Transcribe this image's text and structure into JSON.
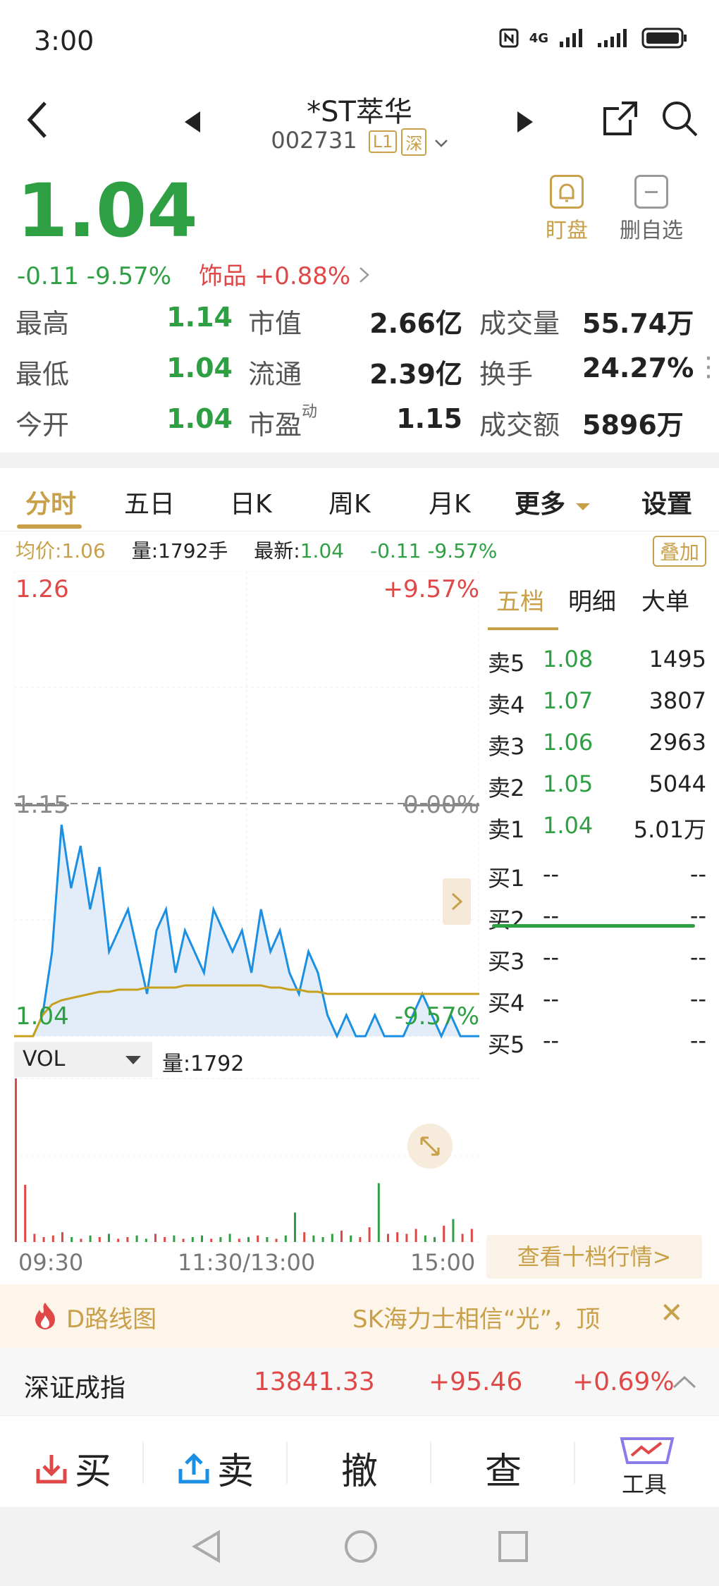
{
  "status": {
    "time": "3:00",
    "network": "4G"
  },
  "header": {
    "name": "*ST萃华",
    "code": "002731",
    "level": "L1",
    "market": "深"
  },
  "quote": {
    "price": "1.04",
    "change": "-0.11",
    "change_pct": "-9.57%",
    "sector_name": "饰品",
    "sector_change": "+0.88%"
  },
  "actions_top": {
    "watch": "盯盘",
    "remove": "删自选"
  },
  "stats": {
    "high_label": "最高",
    "high": "1.14",
    "low_label": "最低",
    "low": "1.04",
    "open_label": "今开",
    "open": "1.04",
    "mcap_label": "市值",
    "mcap": "2.66亿",
    "float_label": "流通",
    "float": "2.39亿",
    "pe_label": "市盈",
    "pe_sup": "动",
    "pe": "1.15",
    "vol_label": "成交量",
    "vol": "55.74万",
    "turnover_label": "换手",
    "turnover": "24.27%",
    "amount_label": "成交额",
    "amount": "5896万"
  },
  "tabs": [
    "分时",
    "五日",
    "日K",
    "周K",
    "月K",
    "更多",
    "设置"
  ],
  "infobar": {
    "avg": "均价:1.06",
    "volume": "量:1792手",
    "latest_label": "最新:",
    "latest": "1.04",
    "chg": "-0.11 -9.57%",
    "overlay": "叠加"
  },
  "chart": {
    "top_price": "1.26",
    "top_pct": "+9.57%",
    "mid_price": "1.15",
    "mid_pct": "0.00%",
    "bottom_price": "1.04",
    "bottom_pct": "-9.57%",
    "vol_selector": "VOL",
    "vol_text": "量:1792",
    "x_start": "09:30",
    "x_mid": "11:30/13:00",
    "x_end": "15:00"
  },
  "chart_data": {
    "type": "line",
    "ylim": [
      1.04,
      1.26
    ],
    "series": [
      {
        "name": "",
        "values": [
          1.04,
          1.04,
          1.04,
          1.05,
          1.08,
          1.14,
          1.11,
          1.13,
          1.1,
          1.12,
          1.08,
          1.09,
          1.1,
          1.08,
          1.06,
          1.09,
          1.1,
          1.07,
          1.09,
          1.08,
          1.07,
          1.1,
          1.09,
          1.08,
          1.09,
          1.07,
          1.1,
          1.08,
          1.09,
          1.07,
          1.06,
          1.08,
          1.07,
          1.05,
          1.04,
          1.05,
          1.04,
          1.04,
          1.05,
          1.04,
          1.04,
          1.04,
          1.05,
          1.06,
          1.05,
          1.04,
          1.05,
          1.04,
          1.04,
          1.04
        ]
      },
      {
        "name": "",
        "values": [
          1.04,
          1.04,
          1.04,
          1.05,
          1.055,
          1.057,
          1.058,
          1.059,
          1.06,
          1.061,
          1.061,
          1.062,
          1.062,
          1.062,
          1.063,
          1.063,
          1.063,
          1.063,
          1.064,
          1.064,
          1.064,
          1.064,
          1.064,
          1.064,
          1.064,
          1.064,
          1.064,
          1.063,
          1.063,
          1.062,
          1.062,
          1.061,
          1.061,
          1.06,
          1.06,
          1.06,
          1.06,
          1.06,
          1.06,
          1.06,
          1.06,
          1.06,
          1.06,
          1.06,
          1.06,
          1.06,
          1.06,
          1.06,
          1.06,
          1.06
        ]
      }
    ],
    "volume": [
      1.0,
      0.35,
      0.05,
      0.03,
      0.04,
      0.06,
      0.03,
      0.02,
      0.04,
      0.03,
      0.05,
      0.02,
      0.03,
      0.04,
      0.02,
      0.05,
      0.03,
      0.04,
      0.02,
      0.03,
      0.04,
      0.02,
      0.03,
      0.05,
      0.02,
      0.03,
      0.04,
      0.03,
      0.02,
      0.04,
      0.18,
      0.06,
      0.04,
      0.03,
      0.05,
      0.07,
      0.04,
      0.03,
      0.09,
      0.36,
      0.05,
      0.06,
      0.05,
      0.08,
      0.04,
      0.03,
      0.1,
      0.14,
      0.05,
      0.08
    ]
  },
  "book": {
    "tabs": [
      "五档",
      "明细",
      "大单"
    ],
    "sell": [
      {
        "label": "卖5",
        "price": "1.08",
        "qty": "1495"
      },
      {
        "label": "卖4",
        "price": "1.07",
        "qty": "3807"
      },
      {
        "label": "卖3",
        "price": "1.06",
        "qty": "2963"
      },
      {
        "label": "卖2",
        "price": "1.05",
        "qty": "5044"
      },
      {
        "label": "卖1",
        "price": "1.04",
        "qty": "5.01万"
      }
    ],
    "buy": [
      {
        "label": "买1",
        "price": "--",
        "qty": "--"
      },
      {
        "label": "买2",
        "price": "--",
        "qty": "--"
      },
      {
        "label": "买3",
        "price": "--",
        "qty": "--"
      },
      {
        "label": "买4",
        "price": "--",
        "qty": "--"
      },
      {
        "label": "买5",
        "price": "--",
        "qty": "--"
      }
    ],
    "more": "查看十档行情>"
  },
  "banner": {
    "left": "D路线图",
    "right": "SK海力士相信“光”，顶"
  },
  "index": {
    "name": "深证成指",
    "value": "13841.33",
    "change": "+95.46",
    "pct": "+0.69%"
  },
  "actions": {
    "buy": "买",
    "sell": "卖",
    "cancel": "撤",
    "query": "查",
    "tools": "工具"
  },
  "colors": {
    "up": "#e04848",
    "down": "#2ea043",
    "accent": "#c8a04a",
    "price_line": "#1a8fe3",
    "avg_line": "#c8a020"
  }
}
